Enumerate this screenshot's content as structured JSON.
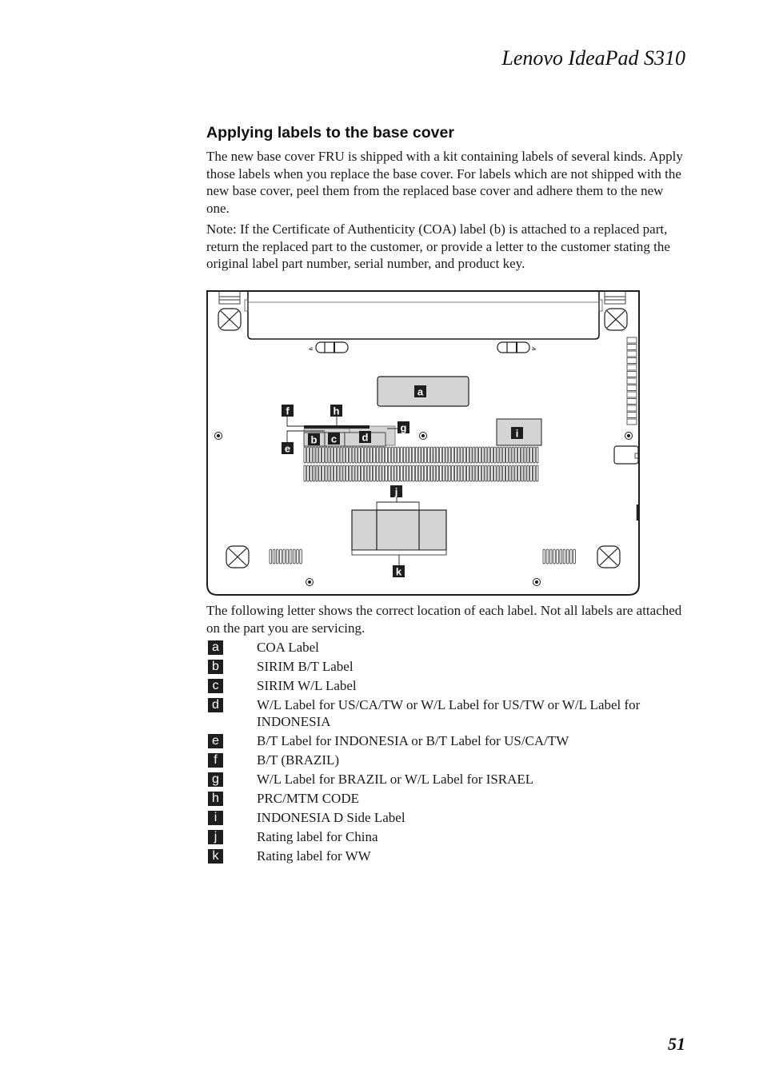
{
  "header": {
    "product": "Lenovo IdeaPad S310"
  },
  "section": {
    "title": "Applying labels to the base cover",
    "intro": "The new base cover FRU is shipped with a kit containing labels of several kinds. Apply those labels when you replace the base cover. For labels which are not shipped with the new base cover, peel them from the replaced base cover and adhere them to the new one.",
    "note": "Note: If the Certificate of Authenticity (COA) label (b) is attached to a replaced part, return the replaced part to the customer, or provide a letter to the customer stating the original label part number, serial number, and product key.",
    "after_figure": "The following letter shows the correct location of each label. Not all labels are attached on the part you are servicing."
  },
  "diagram": {
    "callouts": [
      "a",
      "b",
      "c",
      "d",
      "e",
      "f",
      "g",
      "h",
      "i",
      "j",
      "k"
    ],
    "colors": {
      "label_fill": "#d4d4d4",
      "outline": "#1e1e1e",
      "badge": "#1e1e1e"
    }
  },
  "legend": [
    {
      "letter": "a",
      "text": "COA Label"
    },
    {
      "letter": "b",
      "text": "SIRIM B/T Label"
    },
    {
      "letter": "c",
      "text": "SIRIM W/L Label"
    },
    {
      "letter": "d",
      "text": "W/L Label for US/CA/TW or W/L Label for US/TW or W/L Label for INDONESIA"
    },
    {
      "letter": "e",
      "text": "B/T Label for INDONESIA or B/T Label for US/CA/TW"
    },
    {
      "letter": "f",
      "text": "B/T (BRAZIL)"
    },
    {
      "letter": "g",
      "text": "W/L Label for BRAZIL or W/L Label for ISRAEL"
    },
    {
      "letter": "h",
      "text": "PRC/MTM CODE"
    },
    {
      "letter": "i",
      "text": "INDONESIA D Side Label"
    },
    {
      "letter": "j",
      "text": "Rating label for China"
    },
    {
      "letter": "k",
      "text": "Rating label for WW"
    }
  ],
  "footer": {
    "page_number": "51"
  }
}
